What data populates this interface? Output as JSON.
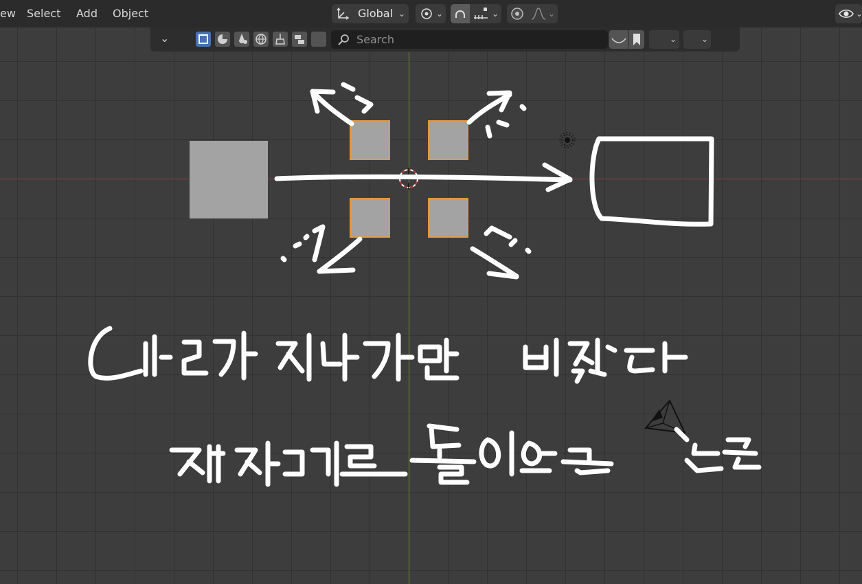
{
  "menu": {
    "view_partial": "ew",
    "select": "Select",
    "add": "Add",
    "object": "Object"
  },
  "transform": {
    "orientation": "Global"
  },
  "outliner_filter": {
    "search_placeholder": "Search"
  },
  "icons": [
    "transform-orientation-icon",
    "pivot-icon",
    "snap-icon",
    "snap-increment-icon",
    "proportional-edit-icon",
    "falloff-icon",
    "visibility-icon",
    "filter-icon",
    "search-icon",
    "bookmark-icon"
  ],
  "colors": {
    "viewport_bg": "#3d3d3d",
    "x_axis": "#9b3a44",
    "y_axis": "#6f8f2a",
    "selection": "#e39a3a",
    "ink": "#ffffff"
  }
}
